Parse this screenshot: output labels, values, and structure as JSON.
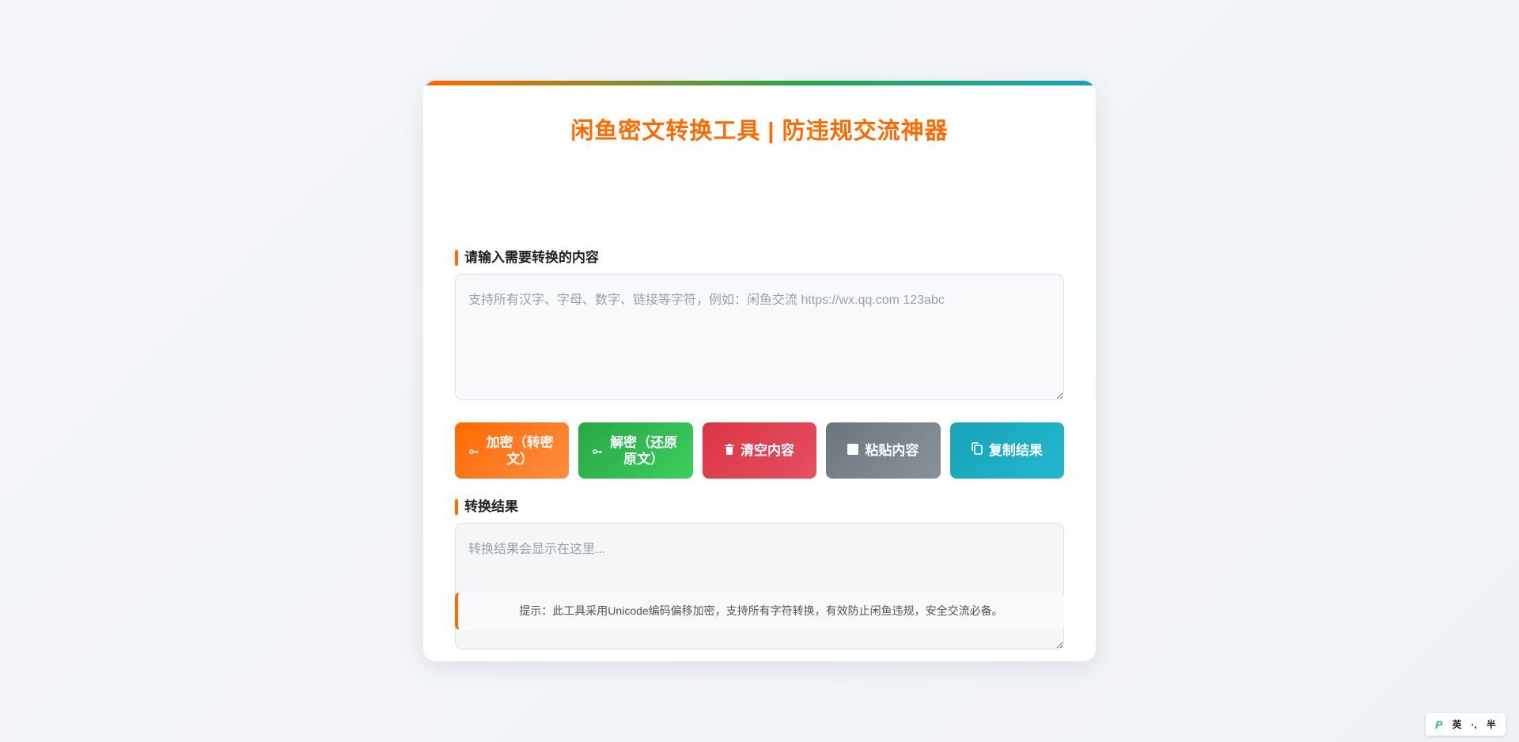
{
  "page": {
    "title": "闲鱼密文转换工具 | 防违规交流神器"
  },
  "input": {
    "label": "请输入需要转换的内容",
    "placeholder": "支持所有汉字、字母、数字、链接等字符，例如：闲鱼交流 https://wx.qq.com 123abc",
    "value": ""
  },
  "buttons": {
    "encrypt": {
      "label": "加密（转密文）",
      "icon": "key-icon"
    },
    "decrypt": {
      "label": "解密（还原原文）",
      "icon": "key-icon"
    },
    "clear": {
      "label": "清空内容",
      "icon": "trash-icon"
    },
    "paste": {
      "label": "粘贴内容",
      "icon": "clipboard-icon"
    },
    "copy": {
      "label": "复制结果",
      "icon": "copy-icon"
    }
  },
  "output": {
    "label": "转换结果",
    "placeholder": "转换结果会显示在这里...",
    "value": ""
  },
  "hint": {
    "text": "提示：此工具采用Unicode编码偏移加密，支持所有字符转换，有效防止闲鱼违规，安全交流必备。"
  },
  "ime": {
    "lang": "英",
    "punct": "·,",
    "width": "半"
  },
  "colors": {
    "accent": "#ff6a00",
    "encrypt": "#ff6a00",
    "decrypt": "#28a745",
    "clear": "#dc3545",
    "paste": "#6c757d",
    "copy": "#17a2b8"
  }
}
